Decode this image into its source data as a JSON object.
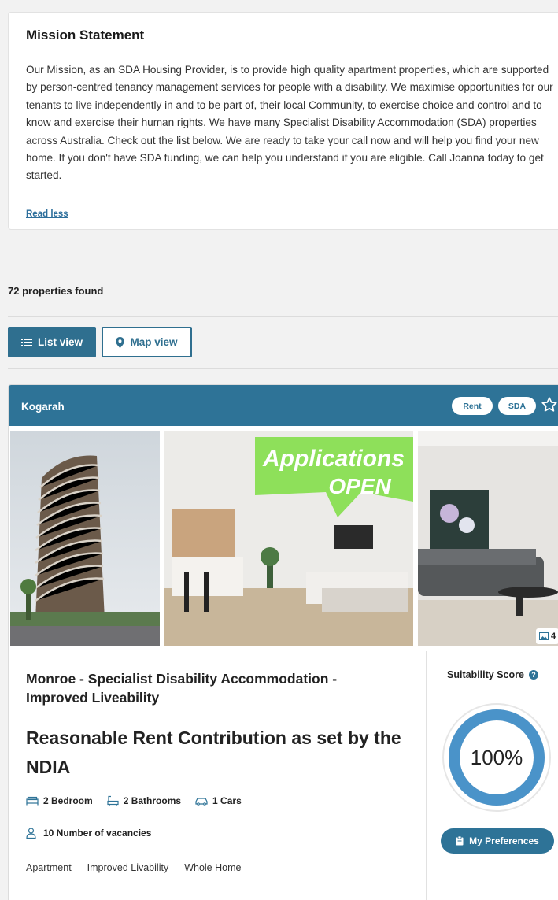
{
  "mission": {
    "title": "Mission Statement",
    "body": "Our Mission, as an SDA Housing Provider, is to provide high quality apartment properties, which are supported by person-centred tenancy management services for people with a disability. We maximise opportunities for our tenants to live independently in and to be part of, their local Community, to exercise choice and control and to know and exercise their human rights. We have many Specialist Disability Accommodation (SDA) properties across Australia. Check out the list below. We are ready to take your call now and will help you find your new home. If you don't have SDA funding, we can help you understand if you are eligible. Call Joanna today to get started.",
    "read_less": "Read less"
  },
  "results": {
    "count_text": "72 properties found"
  },
  "view_toggle": {
    "list_label": "List view",
    "map_label": "Map view",
    "active": "list"
  },
  "property": {
    "suburb": "Kogarah",
    "badges": [
      "Rent",
      "SDA"
    ],
    "gallery": {
      "image_overlay_line1": "Applications",
      "image_overlay_line2": "OPEN",
      "image_count": "4"
    },
    "name": "Monroe - Specialist Disability Accommodation - Improved Liveability",
    "rent": "Reasonable Rent Contribution as set by the NDIA",
    "features": {
      "bedrooms": "2 Bedroom",
      "bathrooms": "2 Bathrooms",
      "cars": "1 Cars"
    },
    "vacancies": "10 Number of vacancies",
    "tags": [
      "Apartment",
      "Improved Livability",
      "Whole Home"
    ],
    "suitability": {
      "label": "Suitability Score",
      "value": "100%",
      "percent": 100
    },
    "preferences_button": "My Preferences"
  },
  "colors": {
    "brand": "#2e7397",
    "ring": "#4a93c9",
    "overlay_green": "#8ee05a"
  }
}
